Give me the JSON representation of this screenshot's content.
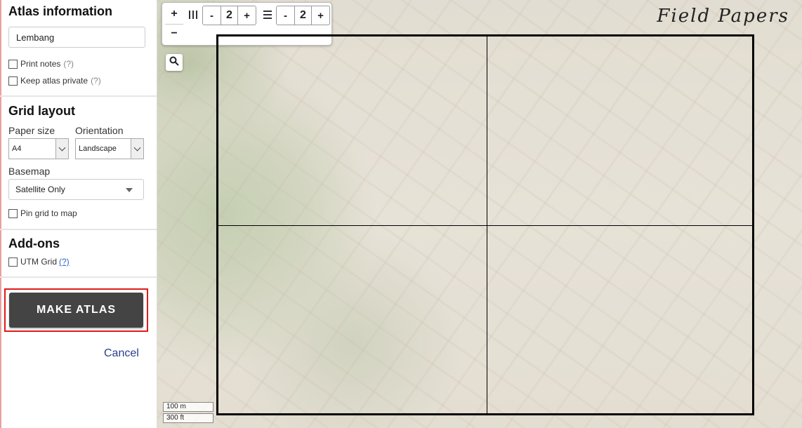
{
  "sidebar": {
    "atlas": {
      "title": "Atlas information",
      "name_value": "Lembang",
      "print_notes": "Print notes",
      "print_notes_help": "(?)",
      "keep_private": "Keep atlas private",
      "keep_private_help": "(?)"
    },
    "grid": {
      "title": "Grid layout",
      "paper_size_label": "Paper size",
      "paper_size_value": "A4",
      "orientation_label": "Orientation",
      "orientation_value": "Landscape",
      "basemap_label": "Basemap",
      "basemap_value": "Satellite Only",
      "pin_grid": "Pin grid to map"
    },
    "addons": {
      "title": "Add-ons",
      "utm_grid": "UTM Grid",
      "utm_help": "(?)"
    },
    "make_atlas": "MAKE ATLAS",
    "cancel": "Cancel"
  },
  "map": {
    "brand": "Field Papers",
    "zoom_in": "+",
    "zoom_out": "−",
    "columns_value": "2",
    "rows_value": "2",
    "minus": "-",
    "plus": "+",
    "scale_metric": "100 m",
    "scale_imperial": "300 ft",
    "grid_columns": 2,
    "grid_rows": 2
  },
  "icons": {
    "columns": "columns-icon",
    "rows": "rows-icon",
    "search": "search-icon"
  }
}
